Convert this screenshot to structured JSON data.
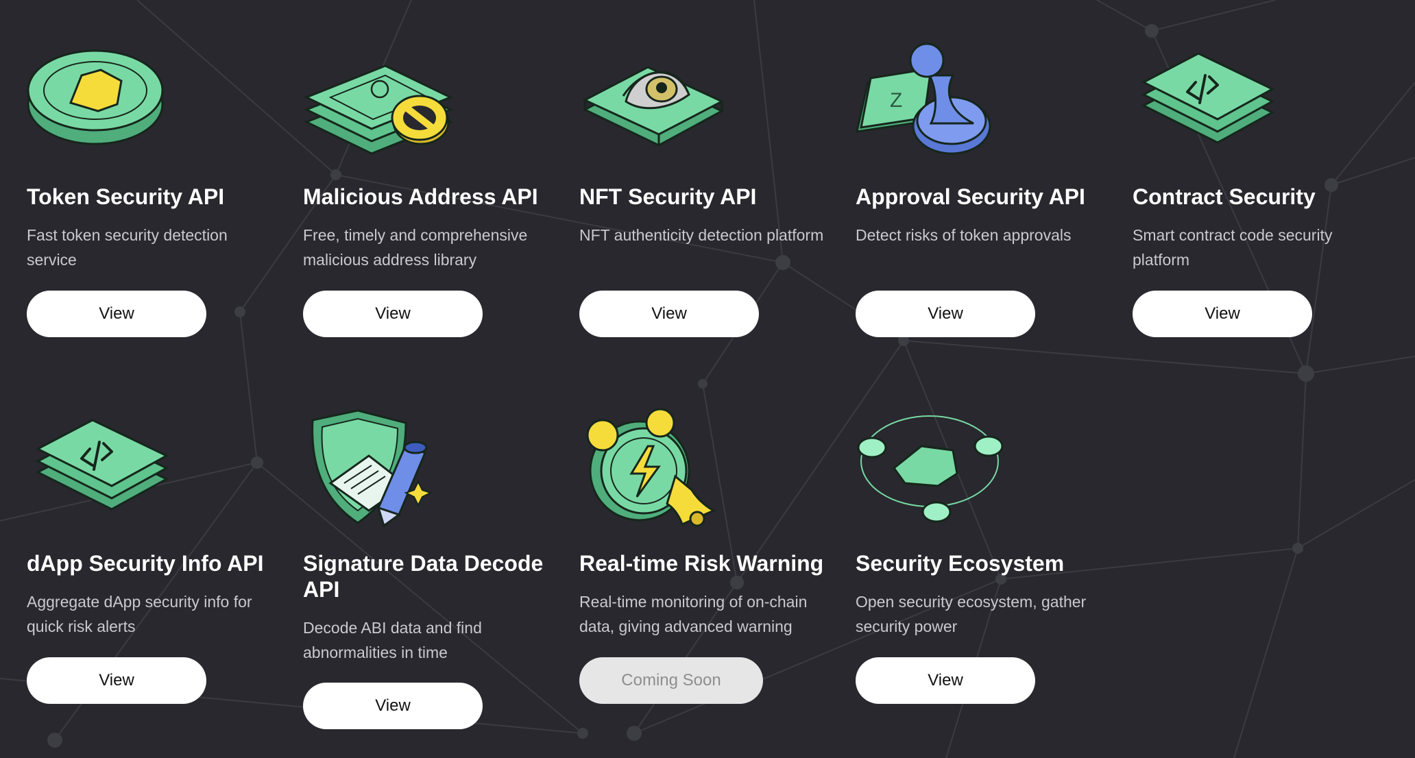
{
  "colors": {
    "background": "#28282e",
    "green": "#79d9a4",
    "green_dark": "#4fae7c",
    "yellow": "#f5dc3b",
    "blue": "#6f8ee8",
    "button": "#ffffff",
    "button_disabled": "#e6e6e6"
  },
  "cards": [
    {
      "title": "Token Security API",
      "desc": "Fast token security detection service",
      "button": "View",
      "icon": "shield-coin-icon"
    },
    {
      "title": "Malicious Address API",
      "desc": "Free, timely and comprehensive malicious address library",
      "button": "View",
      "icon": "banned-money-icon"
    },
    {
      "title": "NFT Security API",
      "desc": "NFT authenticity detection platform",
      "button": "View",
      "icon": "eye-tile-icon"
    },
    {
      "title": "Approval Security API",
      "desc": "Detect risks of token approvals",
      "button": "View",
      "icon": "stamp-icon"
    },
    {
      "title": "Contract Security",
      "desc": "Smart contract code security platform",
      "button": "View",
      "icon": "code-layers-icon"
    },
    {
      "title": "dApp Security Info API",
      "desc": "Aggregate dApp security info for quick risk alerts",
      "button": "View",
      "icon": "code-layers-icon"
    },
    {
      "title": "Signature Data Decode API",
      "desc": "Decode ABI data and find abnormalities in time",
      "button": "View",
      "icon": "shield-pen-icon"
    },
    {
      "title": "Real-time Risk Warning",
      "desc": "Real-time monitoring of on-chain data, giving advanced warning",
      "button": "Coming Soon",
      "icon": "alarm-clock-icon"
    },
    {
      "title": "Security Ecosystem",
      "desc": "Open security ecosystem, gather security power",
      "button": "View",
      "icon": "ecosystem-icon"
    }
  ]
}
